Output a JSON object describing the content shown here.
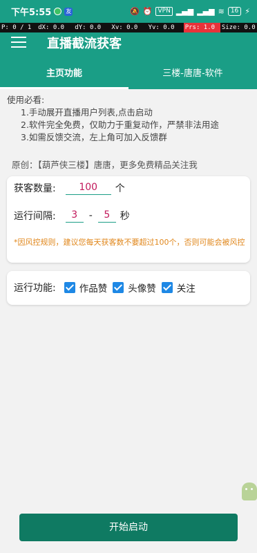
{
  "status_bar": {
    "time": "下午5:55",
    "vpn": "VPN",
    "battery": "16"
  },
  "debug_bar": {
    "p": "P: 0 / 1",
    "dx": "dX: 0.0",
    "dy": "dY: 0.0",
    "xv": "Xv: 0.0",
    "yv": "Yv: 0.0",
    "prs": "Prs: 1.0",
    "size": "Size: 0.0"
  },
  "app_bar": {
    "title": "直播截流获客"
  },
  "tabs": [
    {
      "label": "主页功能",
      "active": true
    },
    {
      "label": "三楼-唐唐-软件",
      "active": false
    }
  ],
  "notice": {
    "heading": "使用必看:",
    "items": [
      "1.手动展开直播用户列表,点击启动",
      "2.软件完全免费，仅助力于重复动作，严禁非法用途",
      "3.如需反馈交流，左上角可加入反馈群"
    ]
  },
  "origin_text": "原创：【葫芦侠三楼】唐唐，更多免费精品关注我",
  "settings": {
    "count_label": "获客数量:",
    "count_value": "100",
    "count_unit": "个",
    "interval_label": "运行间隔:",
    "interval_min": "3",
    "interval_sep": "-",
    "interval_max": "5",
    "interval_unit": "秒",
    "hint": "*因风控规则，建议您每天获客数不要超过100个，否则可能会被风控"
  },
  "functions": {
    "label": "运行功能:",
    "options": [
      {
        "label": "作品赞",
        "checked": true
      },
      {
        "label": "头像赞",
        "checked": true
      },
      {
        "label": "关注",
        "checked": true
      }
    ]
  },
  "start_button": "开始启动",
  "colors": {
    "primary": "#1a9e86",
    "button": "#0f7a62",
    "checkbox": "#1e88e5",
    "hint": "#e0861a",
    "field_text": "#c2185b"
  }
}
